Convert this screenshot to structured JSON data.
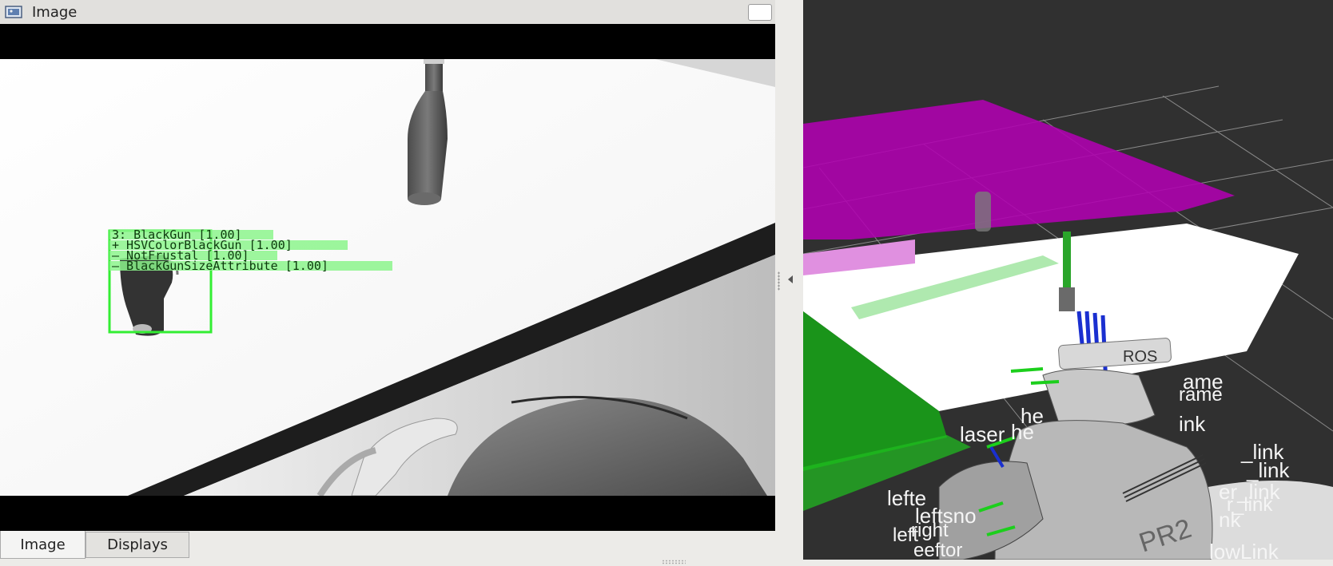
{
  "window": {
    "title": "Image",
    "title_icon": "image-viewer-icon"
  },
  "image_view": {
    "detection": {
      "lines": [
        "3: BlackGun [1.00]",
        " + HSVColorBlackGun [1.00]",
        " –  NotFrustal [1.00]",
        " –  BlackGunSizeAttribute [1.00]"
      ],
      "box_color": "#33ee33",
      "label_bg_color": "#8cf58c"
    }
  },
  "tabs": [
    {
      "label": "Image",
      "active": true
    },
    {
      "label": "Displays",
      "active": false
    }
  ],
  "rviz": {
    "robot_head_logo": "ROS",
    "robot_body_label": "PR2",
    "frame_labels": {
      "l1": "laser",
      "l2": "he",
      "l3": "he",
      "l4": "ame",
      "l5": "rame",
      "l6": "ink",
      "l7": "_link",
      "l8": "_link",
      "l9": "er_link",
      "l10": "r_link",
      "l11": "nk",
      "l12": "lefte",
      "l13": "leftsno",
      "l14": "left",
      "l15": "lowLink",
      "l16": "right",
      "l17": "eeftor"
    },
    "colors": {
      "background": "#303030",
      "table_top": "#ffffff",
      "magenta_plane": "#b000b0",
      "green_plane": "#18a018",
      "grid": "#8a8a8a"
    }
  }
}
